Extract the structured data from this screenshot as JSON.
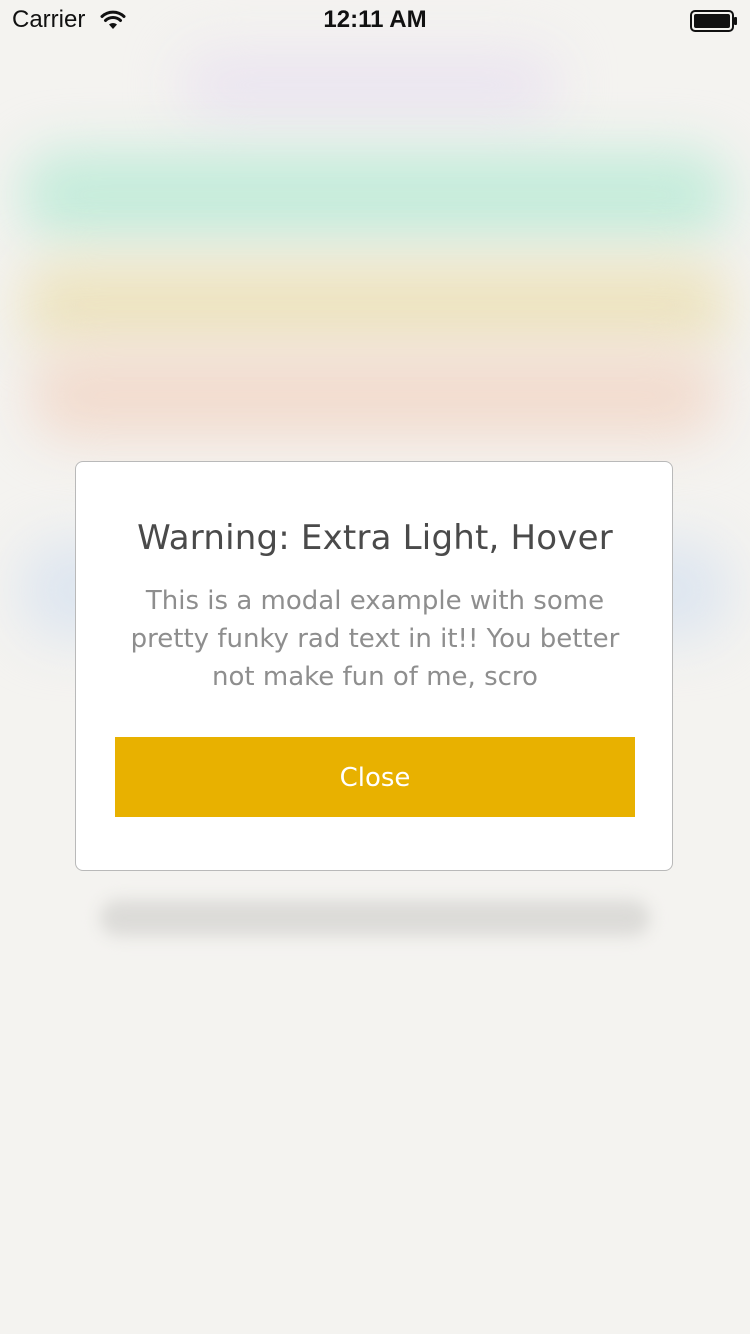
{
  "status_bar": {
    "carrier": "Carrier",
    "time": "12:11 AM",
    "wifi_icon": "wifi-icon",
    "battery_icon": "battery-icon"
  },
  "modal": {
    "title": "Warning: Extra Light, Hover",
    "body": "This is a modal example with some pretty funky rad text in it!! You better not make fun of me, scro",
    "close_label": "Close"
  },
  "colors": {
    "accent": "#e8b100",
    "background": "#f4f3f0",
    "title_text": "#4a4a4a",
    "body_text": "#8e8e8e"
  }
}
